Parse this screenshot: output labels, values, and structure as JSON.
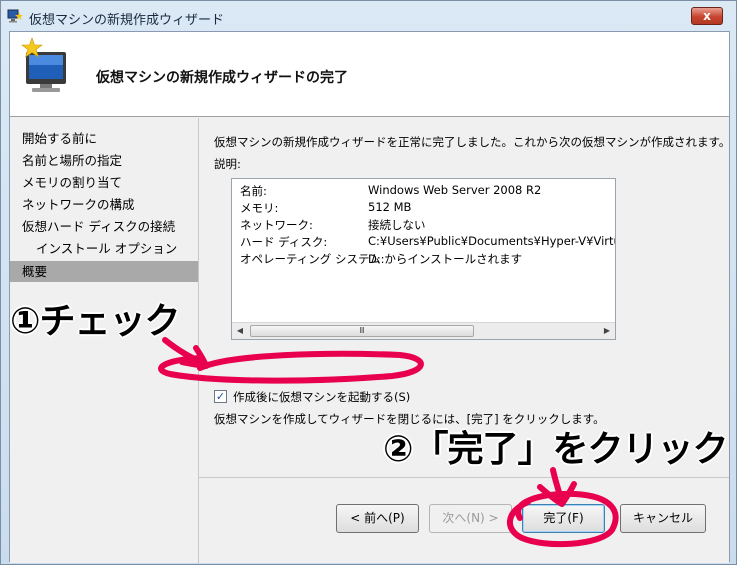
{
  "window": {
    "title": "仮想マシンの新規作成ウィザード",
    "close_label": "x"
  },
  "header": {
    "title": "仮想マシンの新規作成ウィザードの完了"
  },
  "nav": {
    "items": [
      {
        "label": "開始する前に"
      },
      {
        "label": "名前と場所の指定"
      },
      {
        "label": "メモリの割り当て"
      },
      {
        "label": "ネットワークの構成"
      },
      {
        "label": "仮想ハード ディスクの接続"
      },
      {
        "label": "インストール オプション"
      },
      {
        "label": "概要"
      }
    ],
    "selected_index": 6
  },
  "content": {
    "intro": "仮想マシンの新規作成ウィザードを正常に完了しました。これから次の仮想マシンが作成されます。",
    "description_label": "説明:",
    "summary": [
      {
        "key": "名前:",
        "value": "Windows Web Server 2008 R2"
      },
      {
        "key": "メモリ:",
        "value": "512 MB"
      },
      {
        "key": "ネットワーク:",
        "value": "接続しない"
      },
      {
        "key": "ハード ディスク:",
        "value": "C:¥Users¥Public¥Documents¥Hyper-V¥Virtual Hard D"
      },
      {
        "key": "オペレーティング システム:",
        "value": "D: からインストールされます"
      }
    ],
    "scroll_thumb_grip": "Ⅲ",
    "checkbox_label": "作成後に仮想マシンを起動する(S)",
    "checkbox_checked": true,
    "close_hint": "仮想マシンを作成してウィザードを閉じるには、[完了] をクリックします。"
  },
  "buttons": {
    "previous": "< 前へ(P)",
    "next": "次へ(N) >",
    "finish": "完了(F)",
    "cancel": "キャンセル"
  },
  "annotations": {
    "step1": "①チェック",
    "step2": "②「完了」をクリック",
    "highlight_color": "#e8004f"
  }
}
